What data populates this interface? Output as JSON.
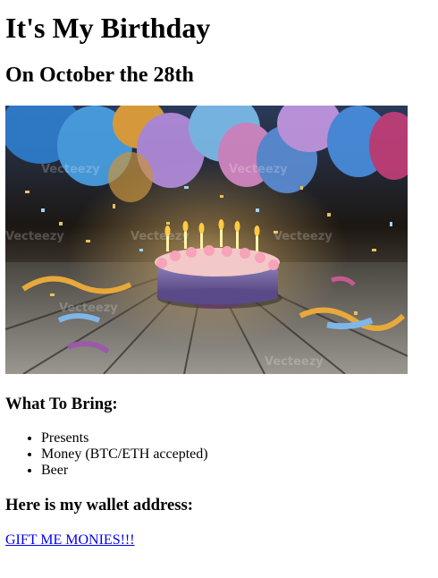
{
  "page": {
    "title": "It's My Birthday",
    "subtitle": "On October the 28th",
    "bring_heading": "What To Bring:",
    "bring_items": [
      "Presents",
      "Money (BTC/ETH accepted)",
      "Beer"
    ],
    "wallet_heading": "Here is my wallet address:",
    "wallet_link_label": "GIFT ME MONIES!!!"
  },
  "hero_image": {
    "alt": "Birthday cake with lit candles, balloons and confetti on wooden floor",
    "watermark": "Vecteezy"
  },
  "colors": {
    "link": "#0000ee",
    "text": "#000000",
    "background": "#ffffff"
  }
}
